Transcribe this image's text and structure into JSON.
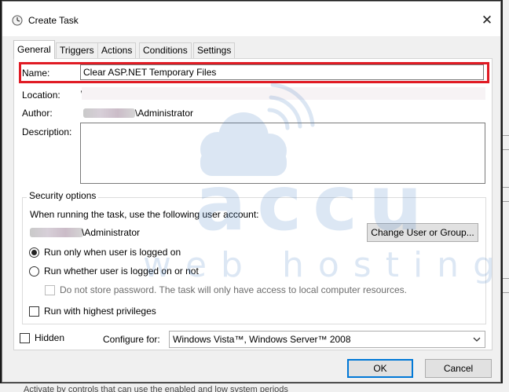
{
  "window": {
    "title": "Create Task",
    "close_symbol": "✕"
  },
  "tabs": [
    {
      "label": "General",
      "active": true
    },
    {
      "label": "Triggers",
      "active": false
    },
    {
      "label": "Actions",
      "active": false
    },
    {
      "label": "Conditions",
      "active": false
    },
    {
      "label": "Settings",
      "active": false
    }
  ],
  "general": {
    "name_label": "Name:",
    "name_value": "Clear ASP.NET Temporary Files",
    "location_label": "Location:",
    "location_value": "\\",
    "author_label": "Author:",
    "author_value": "\\Administrator",
    "description_label": "Description:",
    "description_value": ""
  },
  "security": {
    "legend": "Security options",
    "account_prompt": "When running the task, use the following user account:",
    "account_value": "\\Administrator",
    "change_button": "Change User or Group...",
    "radio_logged_on": "Run only when user is logged on",
    "radio_whether": "Run whether user is logged on or not",
    "no_store_password": "Do not store password.  The task will only have access to local computer resources.",
    "highest_privileges": "Run with highest privileges"
  },
  "footer": {
    "hidden_label": "Hidden",
    "configure_label": "Configure for:",
    "configure_value": "Windows Vista™, Windows Server™ 2008",
    "ok_button": "OK",
    "cancel_button": "Cancel"
  },
  "background": {
    "bottom_text": "Activate by controls that can use the enabled and low system periods"
  },
  "watermark": {
    "line1": "accu",
    "line2": "web hosting"
  },
  "colors": {
    "highlight_red": "#e01b24",
    "default_button_blue": "#0078d7",
    "watermark_blue": "#4f86c6"
  },
  "icons": {
    "app": "clock-icon",
    "close": "close-icon",
    "combo": "chevron-down-icon"
  }
}
